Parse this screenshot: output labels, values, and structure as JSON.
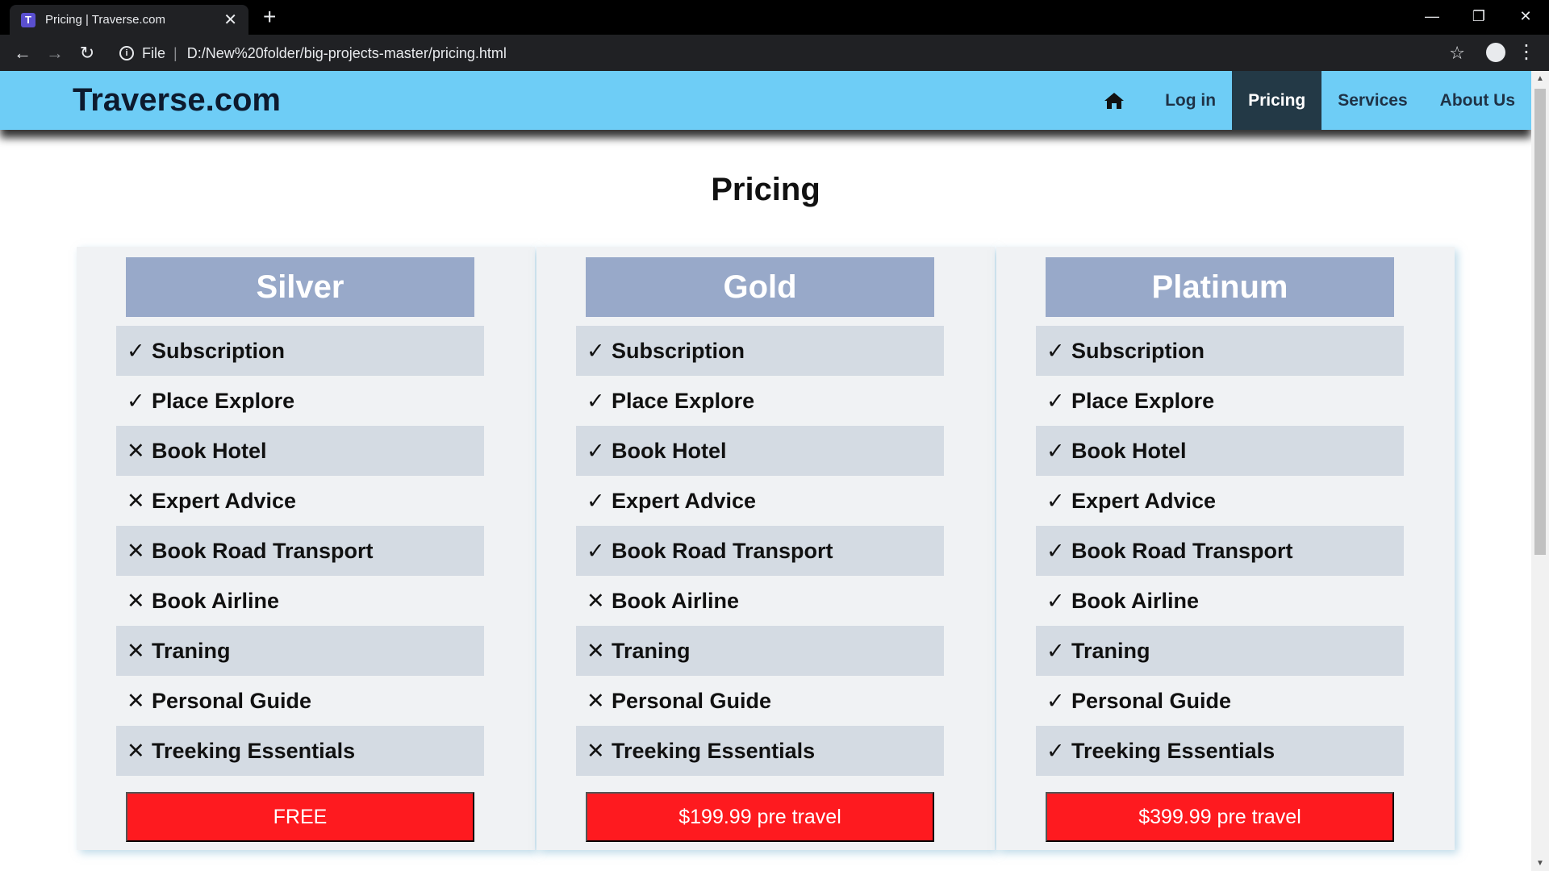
{
  "browser": {
    "tab_title": "Pricing | Traverse.com",
    "tab_favicon": "T",
    "new_tab": "+",
    "omnibox_prefix": "File",
    "url": "D:/New%20folder/big-projects-master/pricing.html"
  },
  "site": {
    "brand": "Traverse.com",
    "nav": [
      {
        "label": "",
        "icon": "home-icon"
      },
      {
        "label": "Log in"
      },
      {
        "label": "Pricing",
        "active": true
      },
      {
        "label": "Services"
      },
      {
        "label": "About Us"
      }
    ],
    "accent_color": "#6ecdf6",
    "button_color": "#fe1a1f"
  },
  "page": {
    "title": "Pricing"
  },
  "plans": [
    {
      "name": "Silver",
      "price_label": "FREE",
      "features": [
        {
          "mark": "✓",
          "label": "Subscription"
        },
        {
          "mark": "✓",
          "label": "Place Explore"
        },
        {
          "mark": "✕",
          "label": "Book Hotel"
        },
        {
          "mark": "✕",
          "label": "Expert Advice"
        },
        {
          "mark": "✕",
          "label": "Book Road Transport"
        },
        {
          "mark": "✕",
          "label": "Book Airline"
        },
        {
          "mark": "✕",
          "label": "Traning"
        },
        {
          "mark": "✕",
          "label": "Personal Guide"
        },
        {
          "mark": "✕",
          "label": "Treeking Essentials"
        }
      ]
    },
    {
      "name": "Gold",
      "price_label": "$199.99 pre travel",
      "features": [
        {
          "mark": "✓",
          "label": "Subscription"
        },
        {
          "mark": "✓",
          "label": "Place Explore"
        },
        {
          "mark": "✓",
          "label": "Book Hotel"
        },
        {
          "mark": "✓",
          "label": "Expert Advice"
        },
        {
          "mark": "✓",
          "label": "Book Road Transport"
        },
        {
          "mark": "✕",
          "label": "Book Airline"
        },
        {
          "mark": "✕",
          "label": "Traning"
        },
        {
          "mark": "✕",
          "label": "Personal Guide"
        },
        {
          "mark": "✕",
          "label": "Treeking Essentials"
        }
      ]
    },
    {
      "name": "Platinum",
      "price_label": "$399.99 pre travel",
      "features": [
        {
          "mark": "✓",
          "label": "Subscription"
        },
        {
          "mark": "✓",
          "label": "Place Explore"
        },
        {
          "mark": "✓",
          "label": "Book Hotel"
        },
        {
          "mark": "✓",
          "label": "Expert Advice"
        },
        {
          "mark": "✓",
          "label": "Book Road Transport"
        },
        {
          "mark": "✓",
          "label": "Book Airline"
        },
        {
          "mark": "✓",
          "label": "Traning"
        },
        {
          "mark": "✓",
          "label": "Personal Guide"
        },
        {
          "mark": "✓",
          "label": "Treeking Essentials"
        }
      ]
    }
  ]
}
